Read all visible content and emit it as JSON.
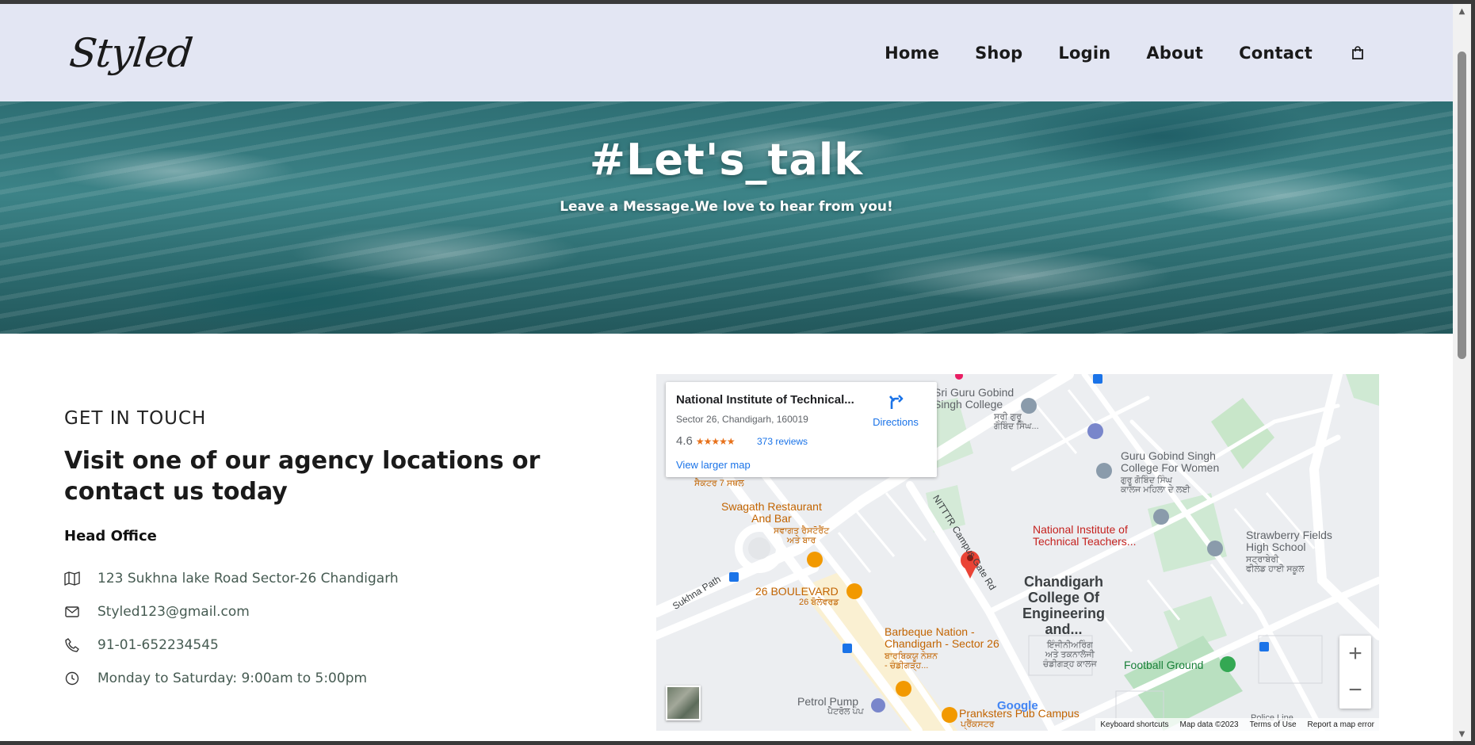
{
  "header": {
    "logo": "Styled",
    "nav": [
      {
        "label": "Home"
      },
      {
        "label": "Shop"
      },
      {
        "label": "Login"
      },
      {
        "label": "About"
      },
      {
        "label": "Contact"
      }
    ],
    "cart_icon": "shopping-bag-icon"
  },
  "hero": {
    "title": "#Let's_talk",
    "subtitle": "Leave a Message.We love to hear from you!"
  },
  "contact": {
    "eyebrow": "GET IN TOUCH",
    "headline": "Visit one of our agency locations or contact us today",
    "office_title": "Head Office",
    "details": [
      {
        "icon": "map-icon",
        "text": "123 Sukhna lake Road Sector-26 Chandigarh"
      },
      {
        "icon": "envelope-icon",
        "text": "Styled123@gmail.com"
      },
      {
        "icon": "phone-icon",
        "text": "91-01-652234545"
      },
      {
        "icon": "clock-icon",
        "text": "Monday to Saturday: 9:00am to 5:00pm"
      }
    ]
  },
  "map": {
    "place_name": "National Institute of Technical...",
    "address": "Sector 26, Chandigarh, 160019",
    "rating": "4.6",
    "stars": "★★★★★",
    "reviews": "373 reviews",
    "larger_map": "View larger map",
    "directions": "Directions",
    "labels": {
      "sri_guru_1": "Sri Guru Gobind",
      "sri_guru_2": "Singh College",
      "sri_guru_pa": "ਸ੍ਰੀ ਗੁਰੂ",
      "sri_guru_pa2": "ਗੋਬਿੰਦ ਸਿੰਘ...",
      "ggs_women_1": "Guru Gobind Singh",
      "ggs_women_2": "College For Women",
      "ggs_women_pa": "ਗੁਰੂ ਗੋਬਿੰਦ ਸਿੰਘ",
      "ggs_women_pa2": "ਕਾਲਜ ਮਹਿਲਾ ਦੇ ਲਈ",
      "swagath_1": "Swagath Restaurant",
      "swagath_2": "And Bar",
      "swagath_pa": "ਸਵਾਗਤ ਰੈਸਟੋਰੈਂਟ",
      "swagath_pa2": "ਅਤੇ ਬਾਰ",
      "sector7_pa": "ਸੈਕਟਰ 7 ਸਥਲ",
      "nitttr_1": "National Institute of",
      "nitttr_2": "Technical Teachers...",
      "nitttr_road": "NITTTR Campus Gate Rd",
      "strawberry_1": "Strawberry Fields",
      "strawberry_2": "High School",
      "strawberry_pa": "ਸਟ੍ਰਾਬੇਰੀ",
      "strawberry_pa2": "ਫੀਲਡ ਹਾਈ ਸਕੂਲ",
      "ccoe_1": "Chandigarh",
      "ccoe_2": "College Of",
      "ccoe_3": "Engineering",
      "ccoe_4": "and...",
      "ccoe_pa": "ਇੰਜੀਨੀਅਰਿੰਗ",
      "ccoe_pa2": "ਅਤੇ ਤਕਨਾਲੋਜੀ",
      "ccoe_pa3": "ਚੰਡੀਗੜ੍ਹ ਕਾਲਜ",
      "sukhna_path": "Sukhna Path",
      "boulevard": "26 BOULEVARD",
      "boulevard_pa": "26 ਬੋਲੇਵਰਡ",
      "bbq_1": "Barbeque Nation -",
      "bbq_2": "Chandigarh - Sector 26",
      "bbq_pa": "ਬਾਰਬਿਕਯੂ ਨੇਸ਼ਨ",
      "bbq_pa2": "- ਚੰਡੀਗੜ੍ਹ...",
      "football": "Football Ground",
      "petrol": "Petrol Pump",
      "petrol_pa": "ਪੈਟਰੋਲ ਪੰਪ",
      "pranksters": "Pranksters Pub Campus",
      "pranksters_pa": "ਪ੍ਰੈਂਕਸਟਰ",
      "police": "Police Line"
    },
    "attribution": [
      "Keyboard shortcuts",
      "Map data ©2023",
      "Terms of Use",
      "Report a map error"
    ],
    "google": "Google",
    "zoom_in": "+",
    "zoom_out": "−"
  },
  "colors": {
    "header_bg": "#e3e6f3",
    "text_dark": "#1a1a1a",
    "detail_text": "#465b52",
    "link_blue": "#1a73e8",
    "poi_orange": "#c26401",
    "pin_red": "#ea4335"
  }
}
